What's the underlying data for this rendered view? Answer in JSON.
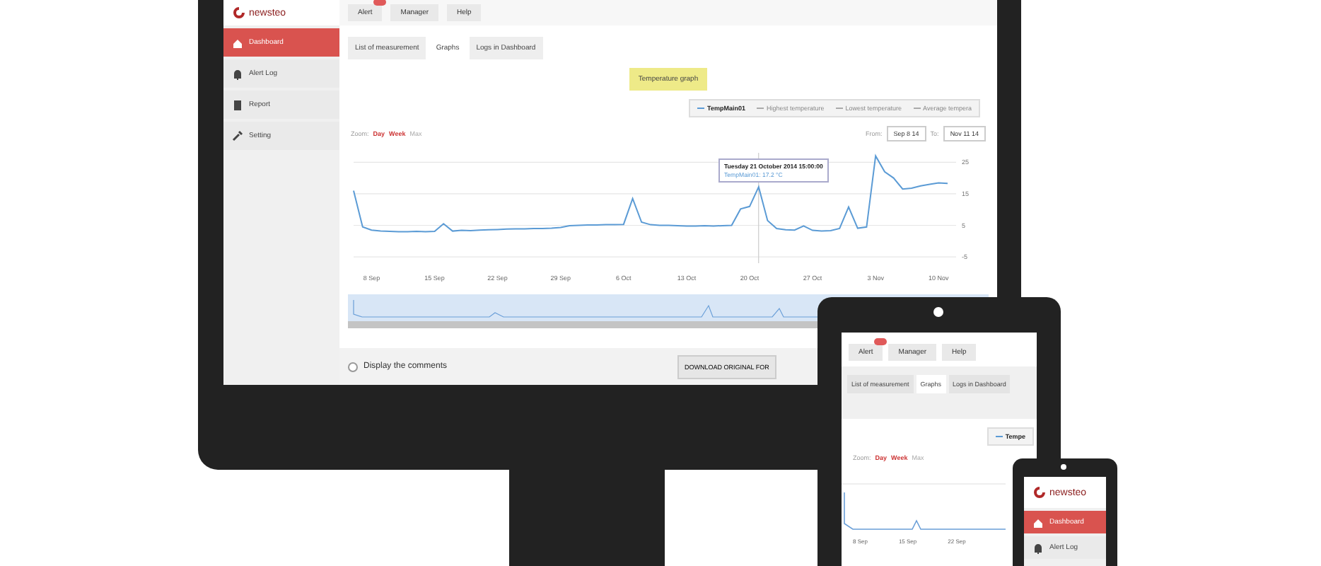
{
  "monitor": {
    "logo": "newsteo",
    "nav": [
      {
        "label": "Alert",
        "badge": true
      },
      {
        "label": "Manager",
        "badge": false
      },
      {
        "label": "Help",
        "badge": false
      }
    ],
    "sidebar": [
      {
        "label": "Dashboard",
        "selected": true
      },
      {
        "label": "Alert Log",
        "selected": false
      },
      {
        "label": "Report",
        "selected": false
      },
      {
        "label": "Setting",
        "selected": false
      }
    ],
    "tabs": [
      {
        "label": "List of measurement",
        "selected": false
      },
      {
        "label": "Graphs",
        "selected": true
      },
      {
        "label": "Logs in Dashboard",
        "selected": false
      }
    ],
    "graph_title": "Temperature graph",
    "legend": [
      {
        "label": "Highest temperature",
        "visible": false
      },
      {
        "label": "Lowest temperature",
        "visible": false
      },
      {
        "label": "Average tempera",
        "visible": false
      }
    ],
    "zoom_label": "Zoom:",
    "zoom_buttons": [
      {
        "label": "Day",
        "selected": true
      },
      {
        "label": "Week",
        "selected": true
      },
      {
        "label": "Max",
        "selected": false
      }
    ],
    "from_label": "From:",
    "from_value": "Sep 8 14",
    "to_label": "To:",
    "to_value": "Nov 11 14",
    "tooltip": {
      "title": "Tuesday 21 October 2014 15:00:00",
      "text": "TempMain01: 17.2 °C"
    },
    "chart_data": {
      "type": "line",
      "categories": [
        null,
        null,
        "8 Sep",
        null,
        null,
        null,
        null,
        null,
        null,
        "15 Sep",
        null,
        null,
        null,
        null,
        null,
        null,
        "22 Sep",
        null,
        null,
        null,
        null,
        null,
        null,
        "29 Sep",
        null,
        null,
        null,
        null,
        null,
        null,
        "6 Oct",
        null,
        null,
        null,
        null,
        null,
        null,
        "13 Oct",
        null,
        null,
        null,
        null,
        null,
        null,
        "20 Oct",
        null,
        null,
        null,
        null,
        null,
        null,
        "27 Oct",
        null,
        null,
        null,
        null,
        null,
        null,
        "3 Nov",
        null,
        null,
        null,
        null,
        null,
        null,
        "10 Nov",
        null
      ],
      "series": [
        {
          "name": "TempMain01",
          "color": "#5b9bd5",
          "values": [
            16,
            4.5,
            3.5,
            3.2,
            3.1,
            3,
            3,
            3.1,
            3,
            3.1,
            5.5,
            3.2,
            3.4,
            3.3,
            3.5,
            3.6,
            3.7,
            3.8,
            3.9,
            3.9,
            4,
            4,
            4.1,
            4.3,
            4.9,
            5,
            5.1,
            5.1,
            5.2,
            5.2,
            5.3,
            13.5,
            6,
            5.2,
            5,
            5,
            4.9,
            4.8,
            4.8,
            4.9,
            4.8,
            4.9,
            5,
            10.2,
            11,
            17.2,
            6.5,
            4,
            3.6,
            3.5,
            4.8,
            3.4,
            3.2,
            3.3,
            4,
            10.8,
            4.1,
            4.5,
            27,
            22,
            20,
            16.5,
            16.8,
            17.5,
            18,
            18.5,
            18.3
          ]
        }
      ],
      "ylim": [
        -7,
        28
      ],
      "grid": true,
      "yticks": [
        -5,
        5,
        15,
        25
      ]
    },
    "comments_label": "Display the comments",
    "download_button": "DOWNLOAD ORIGINAL FOR"
  },
  "tablet": {
    "nav": [
      {
        "label": "Alert",
        "badge": true
      },
      {
        "label": "Manager",
        "badge": false
      },
      {
        "label": "Help",
        "badge": false
      }
    ],
    "tabs": [
      {
        "label": "List of measurement",
        "selected": false
      },
      {
        "label": "Graphs",
        "selected": true
      },
      {
        "label": "Logs in Dashboard",
        "selected": false
      }
    ],
    "legend_first": "Tempe",
    "zoom_label": "Zoom:",
    "zoom_buttons": [
      {
        "label": "Day",
        "selected": true
      },
      {
        "label": "Week",
        "selected": true
      },
      {
        "label": "Max",
        "selected": false
      }
    ],
    "x_labels": [
      "8 Sep",
      "15 Sep",
      "22 Sep"
    ]
  },
  "phone": {
    "logo": "newsteo",
    "sidebar": [
      {
        "label": "Dashboard",
        "selected": true
      },
      {
        "label": "Alert Log",
        "selected": false
      }
    ]
  }
}
